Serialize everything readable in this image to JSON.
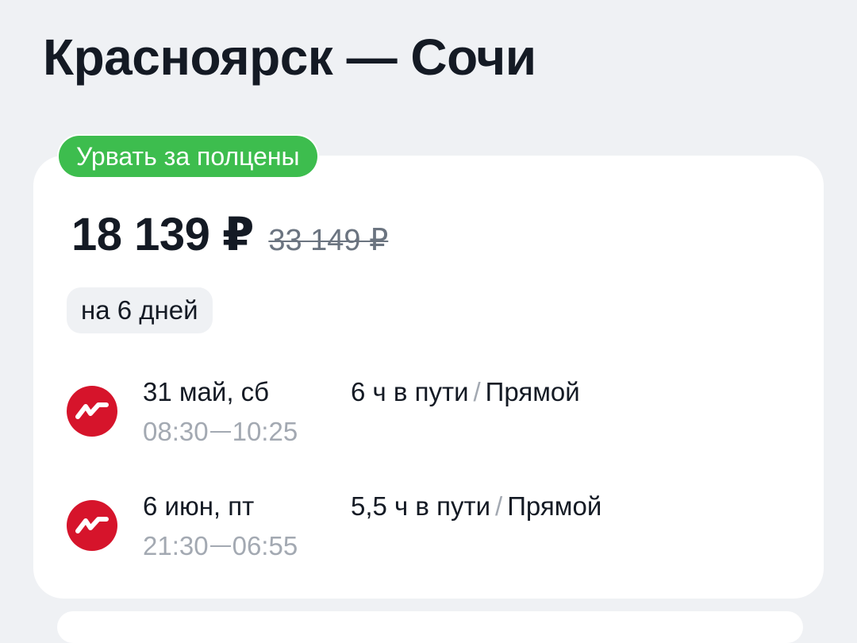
{
  "title": "Красноярск — Сочи",
  "offer": {
    "badge": "Урвать за полцены",
    "price": "18 139 ₽",
    "old_price": "33 149 ₽",
    "duration": "на 6 дней"
  },
  "segments": [
    {
      "airline_icon": "nordwind-logo-icon",
      "date": "31 май, сб",
      "depart": "08:30",
      "arrive": "10:25",
      "travel_time": "6 ч в пути",
      "separator": "/",
      "stops": "Прямой"
    },
    {
      "airline_icon": "nordwind-logo-icon",
      "date": "6 июн, пт",
      "depart": "21:30",
      "arrive": "06:55",
      "travel_time": "5,5 ч в пути",
      "separator": "/",
      "stops": "Прямой"
    }
  ],
  "colors": {
    "background": "#eff1f4",
    "card": "#ffffff",
    "badge": "#3dbd4e",
    "airline": "#d6142b",
    "muted": "#a3a9b2"
  }
}
